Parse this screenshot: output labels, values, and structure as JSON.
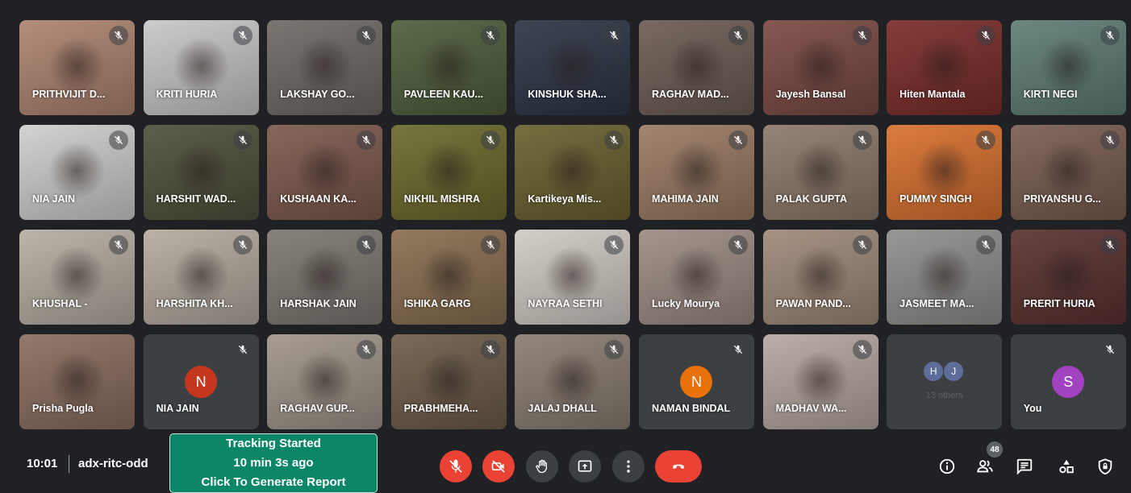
{
  "participants": [
    {
      "name": "PRITHVIJIT D...",
      "bg": "#ae8470",
      "muted": true
    },
    {
      "name": "KRITI HURIA",
      "bg": "#c9c7c8",
      "muted": true
    },
    {
      "name": "LAKSHAY GO...",
      "bg": "#6f6a64",
      "muted": true
    },
    {
      "name": "PAVLEEN KAU...",
      "bg": "#4f5f3c",
      "muted": true
    },
    {
      "name": "KINSHUK SHA...",
      "bg": "#2d3646",
      "muted": true
    },
    {
      "name": "RAGHAV MAD...",
      "bg": "#6d5d55",
      "muted": true
    },
    {
      "name": "Jayesh Bansal",
      "bg": "#7b4a44",
      "muted": true
    },
    {
      "name": "Hiten Mantala",
      "bg": "#7a2d2a",
      "muted": true
    },
    {
      "name": "KIRTI NEGI",
      "bg": "#5f7e75",
      "muted": true
    },
    {
      "name": "NIA JAIN",
      "bg": "#cfcfcd",
      "muted": true
    },
    {
      "name": "HARSHIT WAD...",
      "bg": "#4f513c",
      "muted": true
    },
    {
      "name": "KUSHAAN KA...",
      "bg": "#7d5a4e",
      "muted": true
    },
    {
      "name": "NIKHIL MISHRA",
      "bg": "#6c6a2d",
      "muted": true
    },
    {
      "name": "Kartikeya Mis...",
      "bg": "#6a6230",
      "muted": true
    },
    {
      "name": "MAHIMA JAIN",
      "bg": "#9a7b63",
      "muted": true
    },
    {
      "name": "PALAK GUPTA",
      "bg": "#8d7a6b",
      "muted": true
    },
    {
      "name": "PUMMY SINGH",
      "bg": "#d9712f",
      "muted": true
    },
    {
      "name": "PRIYANSHU G...",
      "bg": "#7a5e52",
      "muted": true
    },
    {
      "name": "KHUSHAL -",
      "bg": "#b6aea3",
      "muted": true
    },
    {
      "name": "HARSHITA KH...",
      "bg": "#b5aba0",
      "muted": true
    },
    {
      "name": "HARSHAK JAIN",
      "bg": "#7d7871",
      "muted": true
    },
    {
      "name": "ISHIKA GARG",
      "bg": "#8a6f51",
      "muted": true
    },
    {
      "name": "NAYRAA SETHI",
      "bg": "#d1cbc4",
      "muted": true
    },
    {
      "name": "Lucky Mourya",
      "bg": "#9d8c84",
      "muted": true
    },
    {
      "name": "PAWAN PAND...",
      "bg": "#9f8a7a",
      "muted": true
    },
    {
      "name": "JASMEET MA...",
      "bg": "#8f8f8e",
      "muted": true
    },
    {
      "name": "PRERIT HURIA",
      "bg": "#5a3231",
      "muted": true
    },
    {
      "name": "Prisha Pugla",
      "bg": "#8b6e5f",
      "muted": false
    },
    {
      "name": "NIA JAIN",
      "bg": "#3c4043",
      "muted": true,
      "avatar": "N",
      "avatar_color": "#c5381d"
    },
    {
      "name": "RAGHAV GUP...",
      "bg": "#a0958a",
      "muted": true
    },
    {
      "name": "PRABHMEHA...",
      "bg": "#6e5d4a",
      "muted": true
    },
    {
      "name": "JALAJ DHALL",
      "bg": "#8a7e73",
      "muted": true
    },
    {
      "name": "NAMAN BINDAL",
      "bg": "#3c4043",
      "muted": true,
      "avatar": "N",
      "avatar_color": "#e8710a"
    },
    {
      "name": "MADHAV WA...",
      "bg": "#b6a7a1",
      "muted": true
    },
    {
      "name": "",
      "bg": "#3c4043",
      "muted": false,
      "others": true,
      "minis": [
        "H",
        "J"
      ],
      "others_label": "13 others"
    },
    {
      "name": "You",
      "bg": "#3c4043",
      "muted": true,
      "avatar": "S",
      "avatar_color": "#a142c0"
    }
  ],
  "meeting": {
    "time": "10:01",
    "code": "adx-ritc-odd"
  },
  "tracking": {
    "line1": "Tracking Started",
    "line2": "10 min 3s ago",
    "line3": "Click To Generate Report"
  },
  "people_count": "48",
  "colors": {
    "end_call": "#ea4335",
    "tracking_bg": "#0b8767",
    "tile_bg": "#3c4043"
  }
}
